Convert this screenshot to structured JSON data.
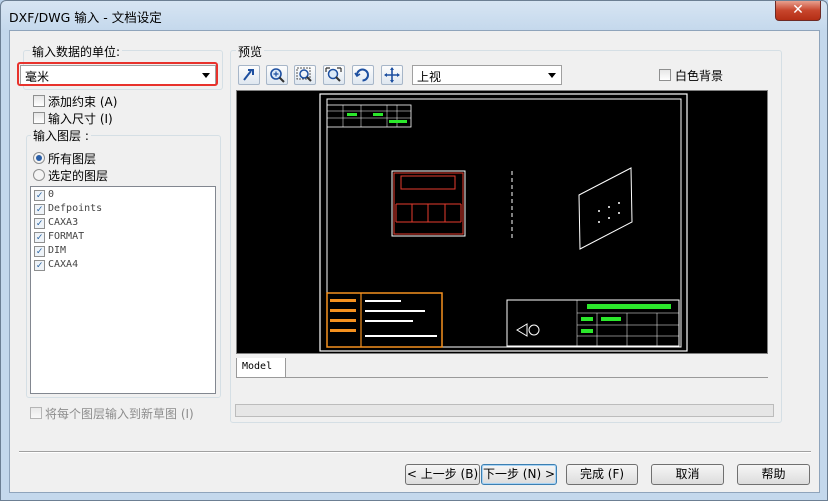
{
  "window": {
    "title": "DXF/DWG 输入 - 文档设定",
    "close_symbol": "✕"
  },
  "units": {
    "label": "输入数据的单位:",
    "selected": "毫米"
  },
  "options": {
    "add_constraints": "添加约束 (A)",
    "import_dimensions": "输入尺寸 (I)"
  },
  "layers": {
    "group_label": "输入图层 :",
    "all_layers": "所有图层",
    "selected_layers": "选定的图层",
    "items": [
      "0",
      "Defpoints",
      "CAXA3",
      "FORMAT",
      "DIM",
      "CAXA4"
    ],
    "check_mark": "✓",
    "each_layer_new_sketch": "将每个图层输入到新草图 (I)"
  },
  "preview": {
    "group_label": "预览",
    "view_selected": "上视",
    "white_background": "白色背景",
    "tab_model": "Model"
  },
  "buttons": {
    "back": "< 上一步 (B)",
    "next": "下一步 (N) >",
    "finish": "完成 (F)",
    "cancel": "取消",
    "help": "帮助"
  }
}
